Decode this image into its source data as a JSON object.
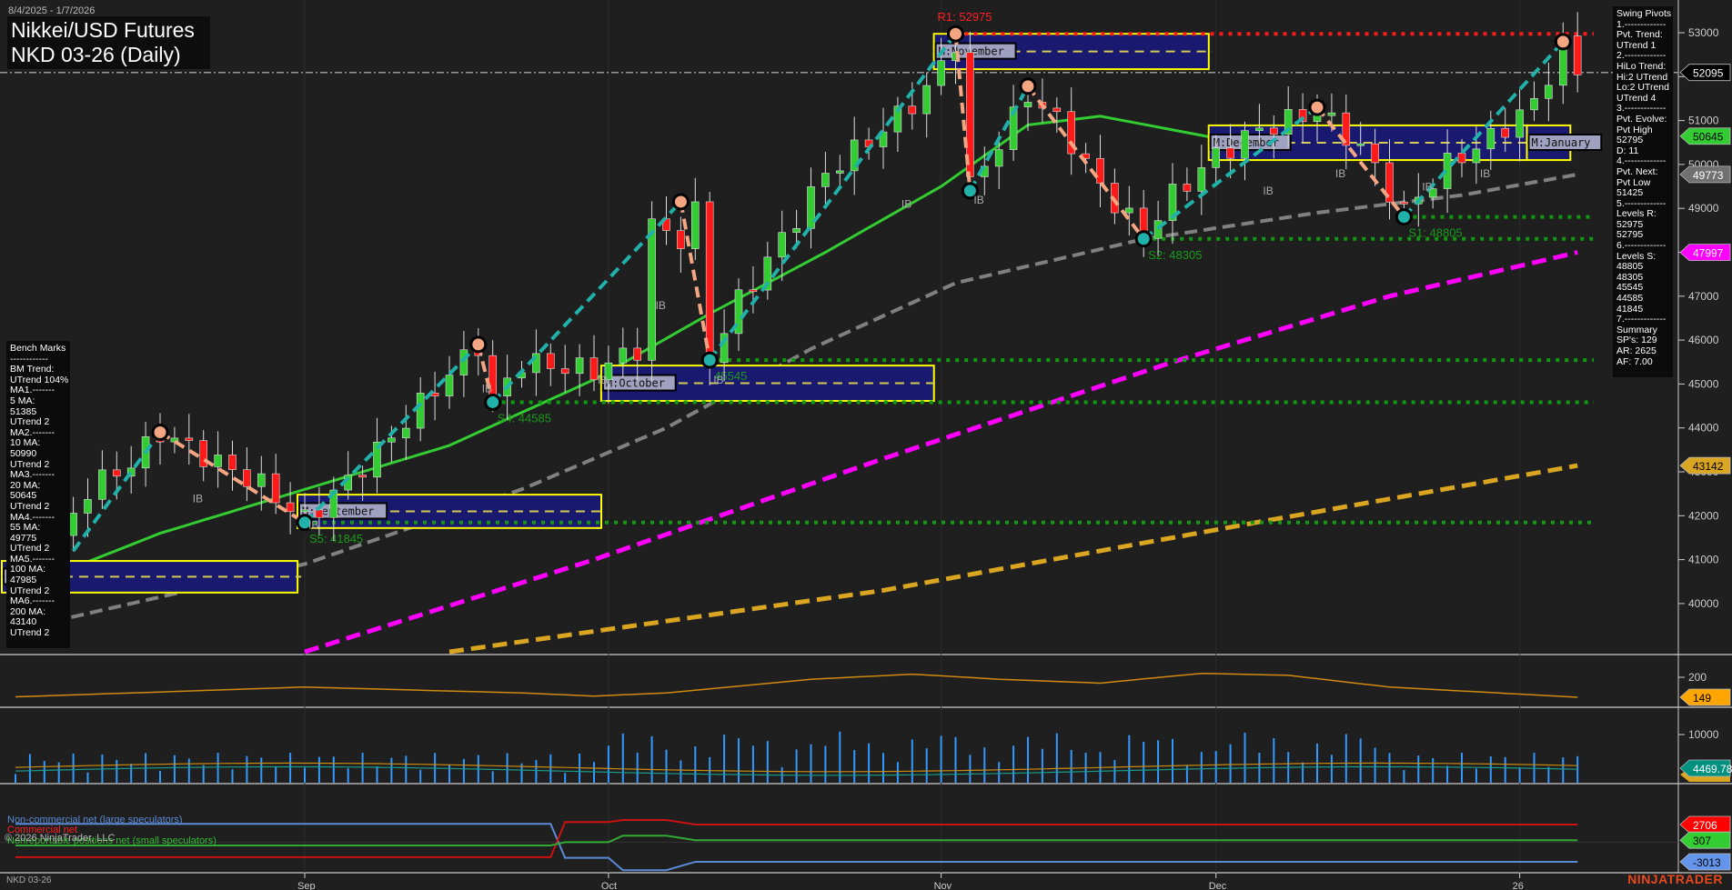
{
  "header": {
    "date_range": "8/4/2025 - 1/7/2026",
    "title_line1": "Nikkei/USD Futures",
    "title_line2": "NKD 03-26 (Daily)"
  },
  "bench_marks": {
    "lines": [
      "Bench Marks",
      "------------",
      "BM Trend:",
      "UTrend 104%",
      "MA1.-------",
      "5 MA:",
      "51385",
      "UTrend 2",
      "MA2.-------",
      "10 MA:",
      "50990",
      "UTrend 2",
      "MA3.-------",
      "20 MA:",
      "50645",
      "UTrend 2",
      "MA4.-------",
      "55 MA:",
      "49775",
      "UTrend 2",
      "MA5.-------",
      "100 MA:",
      "47985",
      "UTrend 2",
      "MA6.-------",
      "200 MA:",
      "43140",
      "UTrend 2"
    ]
  },
  "swing_pivots_panel": {
    "lines": [
      "Swing Pivots",
      "1.-------------",
      "Pvt. Trend:",
      "UTrend 1",
      "2.-------------",
      "HiLo Trend:",
      "Hi:2 UTrend",
      "Lo:2 UTrend",
      "UTrend 4",
      "3.-------------",
      "Pvt. Evolve:",
      "Pvt High",
      "52795",
      "D: 11",
      "4.-------------",
      "Pvt. Next:",
      "Pvt Low",
      "51425",
      "5.-------------",
      "Levels R:",
      "52975",
      "52795",
      "6.-------------",
      "Levels S:",
      "48805",
      "48305",
      "45545",
      "44585",
      "41845",
      "7.-------------",
      "Summary",
      "SP's: 129",
      "AR: 2625",
      "AF: 7.00"
    ]
  },
  "colors": {
    "up": "#33cc33",
    "down": "#ff1a1a",
    "ma20": "#33cc33",
    "ma55": "#808080",
    "ma100": "#ff00ff",
    "ma200": "#daa520",
    "pivot_up": "#20b2aa",
    "pivot_down": "#f4a582",
    "box_fill": "#191970",
    "box_border": "#ffff00"
  },
  "chart_data": {
    "type": "candlestick",
    "price_axis": {
      "ylim": [
        39000,
        53600
      ],
      "ticks": [
        40000,
        41000,
        42000,
        43000,
        44000,
        45000,
        46000,
        47000,
        48000,
        49000,
        50000,
        51000,
        52000,
        53000
      ]
    },
    "x_ticks": [
      {
        "label": "Sep",
        "index": 20
      },
      {
        "label": "Oct",
        "index": 41
      },
      {
        "label": "Nov",
        "index": 64
      },
      {
        "label": "Dec",
        "index": 83
      },
      {
        "label": "26",
        "index": 104
      }
    ],
    "price_path": [
      [
        0,
        40600
      ],
      [
        3,
        41400
      ],
      [
        5,
        42600
      ],
      [
        8,
        43200
      ],
      [
        10,
        43900
      ],
      [
        14,
        43200
      ],
      [
        17,
        42700
      ],
      [
        20,
        41900
      ],
      [
        23,
        42800
      ],
      [
        26,
        43800
      ],
      [
        29,
        44900
      ],
      [
        32,
        45900
      ],
      [
        33,
        44600
      ],
      [
        35,
        45500
      ],
      [
        40,
        45300
      ],
      [
        43,
        45800
      ],
      [
        44,
        48600
      ],
      [
        46,
        48300
      ],
      [
        47,
        48900
      ],
      [
        48,
        45600
      ],
      [
        50,
        46900
      ],
      [
        53,
        48300
      ],
      [
        56,
        49800
      ],
      [
        60,
        50800
      ],
      [
        63,
        51700
      ],
      [
        65,
        52800
      ],
      [
        66,
        49500
      ],
      [
        68,
        50500
      ],
      [
        70,
        51600
      ],
      [
        72,
        51000
      ],
      [
        75,
        49500
      ],
      [
        78,
        48400
      ],
      [
        80,
        49300
      ],
      [
        83,
        50200
      ],
      [
        86,
        50800
      ],
      [
        90,
        51200
      ],
      [
        93,
        50400
      ],
      [
        96,
        48900
      ],
      [
        99,
        50000
      ],
      [
        102,
        50600
      ],
      [
        105,
        51400
      ],
      [
        107,
        52700
      ],
      [
        108,
        52095
      ]
    ],
    "moving_averages": [
      {
        "name": "20 MA",
        "color_key": "ma20",
        "points": [
          [
            0,
            40300
          ],
          [
            10,
            41600
          ],
          [
            20,
            42600
          ],
          [
            30,
            43600
          ],
          [
            40,
            45100
          ],
          [
            48,
            46600
          ],
          [
            56,
            48000
          ],
          [
            64,
            49500
          ],
          [
            70,
            50900
          ],
          [
            75,
            51100
          ],
          [
            83,
            50600
          ],
          [
            90,
            50400
          ],
          [
            100,
            50500
          ],
          [
            108,
            50645
          ]
        ],
        "last": "50645"
      },
      {
        "name": "55 MA",
        "color_key": "ma55",
        "points": [
          [
            0,
            39400
          ],
          [
            20,
            40900
          ],
          [
            35,
            42600
          ],
          [
            45,
            44000
          ],
          [
            55,
            45800
          ],
          [
            65,
            47300
          ],
          [
            78,
            48300
          ],
          [
            90,
            48900
          ],
          [
            100,
            49300
          ],
          [
            108,
            49773
          ]
        ],
        "last": "49773"
      },
      {
        "name": "100 MA",
        "color_key": "ma100",
        "points": [
          [
            20,
            38900
          ],
          [
            40,
            41000
          ],
          [
            60,
            43300
          ],
          [
            80,
            45500
          ],
          [
            95,
            47000
          ],
          [
            108,
            47997
          ]
        ],
        "last": "47997"
      },
      {
        "name": "200 MA",
        "color_key": "ma200",
        "points": [
          [
            30,
            38900
          ],
          [
            60,
            40300
          ],
          [
            85,
            41800
          ],
          [
            108,
            43142
          ]
        ],
        "last": "43142"
      }
    ],
    "swing_pivots": [
      [
        4,
        41200,
        "L"
      ],
      [
        10,
        43900,
        "H"
      ],
      [
        20,
        41845,
        "L"
      ],
      [
        32,
        45900,
        "H"
      ],
      [
        33,
        44585,
        "L"
      ],
      [
        46,
        49150,
        "H"
      ],
      [
        48,
        45545,
        "L"
      ],
      [
        65,
        52975,
        "H"
      ],
      [
        66,
        49400,
        "L"
      ],
      [
        70,
        51780,
        "H"
      ],
      [
        78,
        48305,
        "L"
      ],
      [
        90,
        51300,
        "H"
      ],
      [
        96,
        48805,
        "L"
      ],
      [
        107,
        52795,
        "H"
      ]
    ],
    "levels": [
      {
        "label": "R1: 52975",
        "price": 52975,
        "from": 65,
        "kind": "R"
      },
      {
        "label": "S1: 48805",
        "price": 48805,
        "from": 96,
        "kind": "S"
      },
      {
        "label": "S2: 48305",
        "price": 48305,
        "from": 78,
        "kind": "S"
      },
      {
        "label": "45545",
        "price": 45545,
        "from": 48,
        "kind": "S"
      },
      {
        "label": "S4: 44585",
        "price": 44585,
        "from": 33,
        "kind": "S"
      },
      {
        "label": "S5: 41845",
        "price": 41845,
        "from": 20,
        "kind": "S"
      }
    ],
    "last_price": "52095",
    "last_price_value": 52095,
    "monthly_boxes": [
      {
        "label": "M:August",
        "from": -1,
        "to": 19,
        "hi": 40970,
        "lo": 40250
      },
      {
        "label": "M:September",
        "from": 20,
        "to": 40,
        "hi": 42480,
        "lo": 41720
      },
      {
        "label": "M:October",
        "from": 41,
        "to": 63,
        "hi": 45420,
        "lo": 44615
      },
      {
        "label": "M:November",
        "from": 64,
        "to": 82,
        "hi": 52975,
        "lo": 52170
      },
      {
        "label": "M:December",
        "from": 83,
        "to": 104,
        "hi": 50890,
        "lo": 50100
      },
      {
        "label": "M:January",
        "from": 105,
        "to": 107,
        "hi": 50890,
        "lo": 50100
      }
    ],
    "ib_markers": [
      [
        12,
        42600
      ],
      [
        20,
        42000
      ],
      [
        32,
        45100
      ],
      [
        40,
        45300
      ],
      [
        44,
        47000
      ],
      [
        48,
        45300
      ],
      [
        61,
        49300
      ],
      [
        66,
        49400
      ],
      [
        86,
        49600
      ],
      [
        91,
        50000
      ],
      [
        97,
        49700
      ],
      [
        101,
        50000
      ]
    ],
    "indicator": {
      "axis_tick": "200",
      "tick_value": 200,
      "last": "149",
      "points": [
        [
          0,
          150
        ],
        [
          12,
          165
        ],
        [
          20,
          175
        ],
        [
          27,
          168
        ],
        [
          35,
          160
        ],
        [
          40,
          152
        ],
        [
          45,
          160
        ],
        [
          55,
          195
        ],
        [
          62,
          208
        ],
        [
          68,
          195
        ],
        [
          75,
          185
        ],
        [
          82,
          210
        ],
        [
          88,
          205
        ],
        [
          95,
          175
        ],
        [
          108,
          149
        ]
      ]
    },
    "volume": {
      "axis_tick": "10000",
      "tick_value": 10000,
      "last": "4469.78"
    },
    "cot": {
      "series": [
        {
          "name": "Non-commercial net (large speculators)",
          "color": "#5b8bd6",
          "last": "-3013",
          "tag_color": "#6495ed",
          "points": [
            [
              0,
              2800
            ],
            [
              37,
              2800
            ],
            [
              38,
              -2400
            ],
            [
              41,
              -2400
            ],
            [
              42,
              -4300
            ],
            [
              45,
              -4300
            ],
            [
              47,
              -3013
            ],
            [
              108,
              -3013
            ]
          ]
        },
        {
          "name": "Commercial net",
          "color": "#cc1111",
          "last": "2706",
          "tag_color": "#ff0000",
          "points": [
            [
              0,
              -2300
            ],
            [
              37,
              -2300
            ],
            [
              38,
              3100
            ],
            [
              41,
              3100
            ],
            [
              42,
              3400
            ],
            [
              45,
              3400
            ],
            [
              47,
              2706
            ],
            [
              108,
              2706
            ]
          ]
        },
        {
          "name": "Nonreportable positions net (small speculators)",
          "color": "#33aa33",
          "last": "307",
          "tag_color": "#33cc33",
          "points": [
            [
              0,
              -500
            ],
            [
              37,
              -500
            ],
            [
              38,
              0
            ],
            [
              41,
              0
            ],
            [
              42,
              1000
            ],
            [
              45,
              1000
            ],
            [
              47,
              307
            ],
            [
              108,
              307
            ]
          ]
        }
      ]
    }
  },
  "footer": {
    "copyright": "© 2026 NinjaTrader, LLC",
    "instrument": "NKD 03-26",
    "brand": "NINJATRADER"
  }
}
